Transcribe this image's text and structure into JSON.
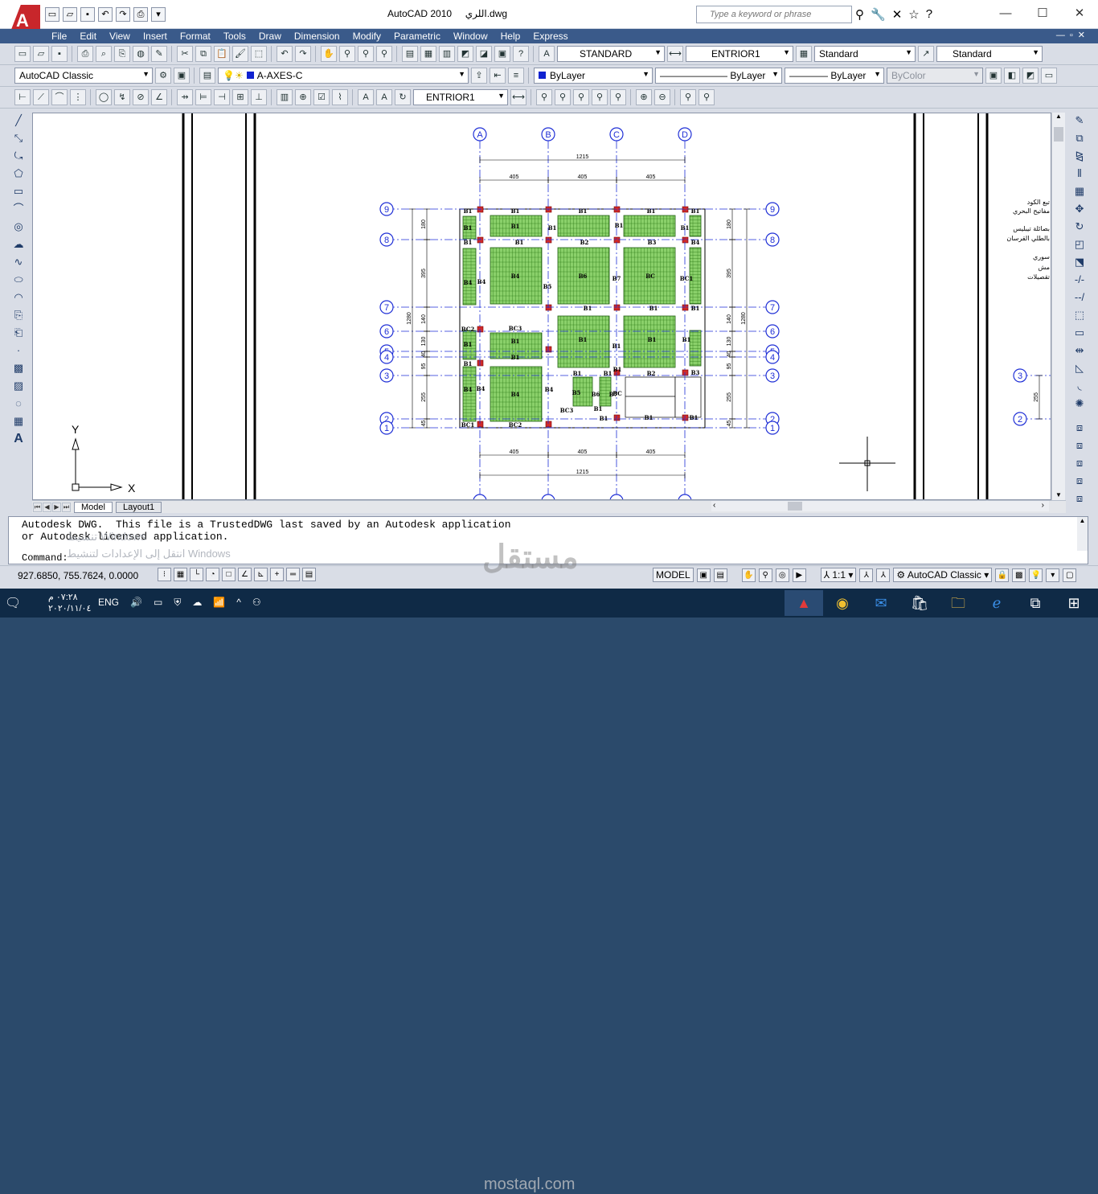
{
  "window": {
    "app_title": "AutoCAD 2010",
    "file_name": "اللري.dwg",
    "logo": "A",
    "search_placeholder": "Type a keyword or phrase",
    "minimize": "—",
    "maximize": "☐",
    "close": "✕"
  },
  "menus": [
    "File",
    "Edit",
    "View",
    "Insert",
    "Format",
    "Tools",
    "Draw",
    "Dimension",
    "Modify",
    "Parametric",
    "Window",
    "Help",
    "Express"
  ],
  "toolbars": {
    "text_style": "STANDARD",
    "dim_style": "ENTRIOR1",
    "table_style": "Standard",
    "mleader_style": "Standard",
    "workspace": "AutoCAD Classic",
    "layer": "A-AXES-C",
    "color": "ByLayer",
    "linetype": "ByLayer",
    "lineweight": "ByLayer",
    "plotstyle": "ByColor",
    "dim_style_2": "ENTRIOR1"
  },
  "drawing": {
    "column_axes": [
      "A",
      "B",
      "C",
      "D"
    ],
    "row_axes_left": [
      "9",
      "8",
      "7",
      "6",
      "5",
      "4",
      "3",
      "2",
      "1"
    ],
    "dims_top": {
      "total": "1215",
      "bay1": "405",
      "bay2": "405",
      "bay3": "405"
    },
    "dims_side": {
      "total": "1280",
      "d1": "180",
      "d2": "395",
      "d3": "140",
      "d4": "130",
      "d5": "40",
      "d6": "95",
      "d7": "255",
      "d8": "45"
    },
    "slab_labels": [
      "B1",
      "B1",
      "B1",
      "B1",
      "B1",
      "B1",
      "B1",
      "B1",
      "B1",
      "B1",
      "B1",
      "B1",
      "B2",
      "B3",
      "B4",
      "B4",
      "B4",
      "B4",
      "B5",
      "B6",
      "B7",
      "BC",
      "BC1",
      "BC2",
      "BC3"
    ],
    "axis_labels": {
      "x": "X",
      "y": "Y"
    },
    "right_notes": [
      "تبع الكود",
      "مفاتيح البحري",
      "بصائلة تيبليس",
      "بالطلي القرسان",
      "سوري",
      "مش",
      "تقصيلات"
    ],
    "right_axes": [
      "3",
      "2"
    ],
    "right_dim": "255"
  },
  "tabs": {
    "model": "Model",
    "layout": "Layout1"
  },
  "command": {
    "line1": "Autodesk DWG.  This file is a TrustedDWG last saved by an Autodesk application",
    "line2": "or Autodesk licensed application.",
    "prompt": "Command:",
    "activation1": "تنشيط Windows",
    "activation2": "انتقل إلى الإعدادات لتنشيط Windows"
  },
  "status": {
    "coordinates": "927.6850, 755.7624, 0.0000",
    "model": "MODEL",
    "scale": "1:1",
    "workspace": "AutoCAD Classic"
  },
  "taskbar": {
    "time": "٠٧:٢٨ م",
    "date": "٢٠٢٠/١١/٠٤",
    "lang": "ENG"
  },
  "watermark": {
    "brand": "مستقل",
    "site": "mostaql.com"
  },
  "colors": {
    "menubar": "#3a5a8a",
    "slab_fill": "#8ad06a",
    "axis_blue": "#1f2fd6",
    "column_red": "#cf2a2a"
  }
}
